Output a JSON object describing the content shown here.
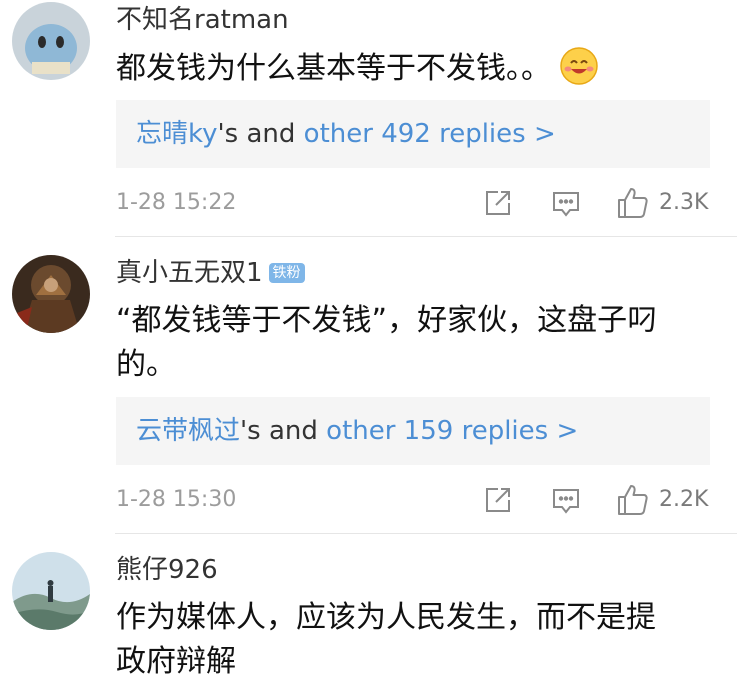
{
  "comments": [
    {
      "username": "不知名ratman",
      "text": "都发钱为什么基本等于不发钱。。",
      "emoji": "smiling-face-icon",
      "reply_user": "忘晴ky",
      "reply_mid": "'s and ",
      "reply_more": "other 492 replies >",
      "time": "1-28 15:22",
      "likes": "2.3K"
    },
    {
      "username": "真小五无双1",
      "badge": "铁粉",
      "text": "“都发钱等于不发钱”，好家伙，这盘子叼的。",
      "reply_user": "云带枫过",
      "reply_mid": "'s and ",
      "reply_more": "other 159 replies >",
      "time": "1-28 15:30",
      "likes": "2.2K"
    },
    {
      "username": "熊仔926",
      "text": "作为媒体人，应该为人民发生，而不是提政府辩解"
    }
  ],
  "colors": {
    "link": "#4c8ed4",
    "badge": "#7fb6e8",
    "reply_bg": "#f5f5f5"
  }
}
